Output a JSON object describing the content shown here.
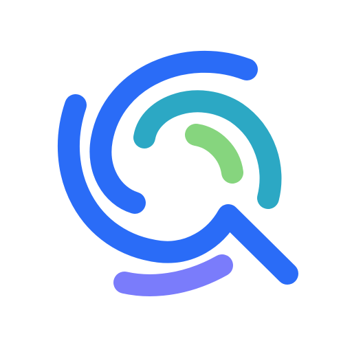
{
  "logo": {
    "icon": "search-swirl-logo-icon",
    "colors": {
      "outer_blue": "#2A6CF7",
      "teal": "#2CA8C4",
      "green": "#86D57E",
      "purple": "#7A7CFB",
      "background": "#FFFFFF"
    }
  }
}
